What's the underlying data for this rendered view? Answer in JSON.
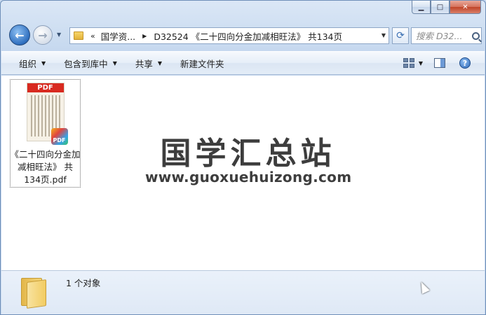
{
  "window": {
    "minimize_icon": "minimize-icon",
    "maximize_icon": "maximize-icon",
    "close_icon": "close-icon",
    "minimize_glyph": "▁",
    "maximize_glyph": "□",
    "close_glyph": "✕"
  },
  "nav": {
    "back_glyph": "←",
    "forward_glyph": "→",
    "history_glyph": "▼"
  },
  "address": {
    "overflow": "«",
    "segments": [
      "国学资...",
      "D32524 《二十四向分金加减相旺法》 共134页"
    ],
    "separator": "▶",
    "dropdown": "▼"
  },
  "refresh_glyph": "⟳",
  "search": {
    "placeholder": "搜索 D32..."
  },
  "toolbar": {
    "organize": "组织",
    "include_in_library": "包含到库中",
    "share": "共享",
    "new_folder": "新建文件夹",
    "caret": "▼",
    "help_glyph": "?"
  },
  "files": [
    {
      "name": "《二十四向分金加减相旺法》 共134页.pdf",
      "thumb_label": "PDF",
      "badge_label": "PDF",
      "icon": "pdf-file-icon"
    }
  ],
  "watermark": {
    "chinese": "国学汇总站",
    "url": "www.guoxuehuizong.com"
  },
  "details": {
    "object_count": "1 个对象"
  },
  "colors": {
    "pdf_red": "#d82a20",
    "window_frame": "#c9daf0",
    "accent_blue": "#2f6fbf"
  }
}
